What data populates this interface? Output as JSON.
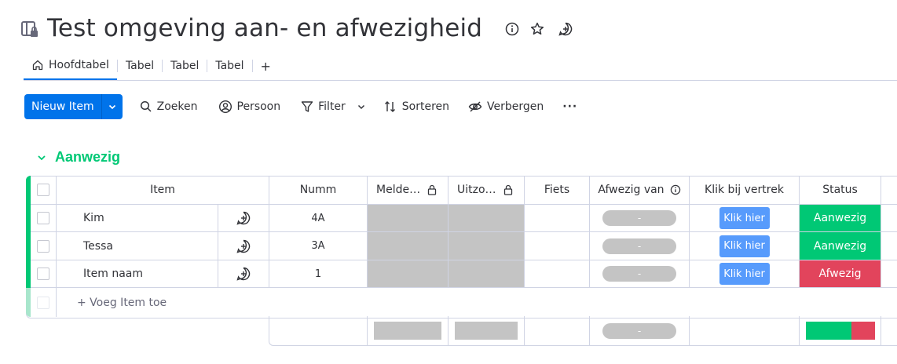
{
  "board": {
    "title": "Test omgeving aan- en afwezigheid",
    "icons": [
      "board-lock-icon",
      "info-icon",
      "star-icon",
      "add-update-icon"
    ]
  },
  "tabs": [
    {
      "label": "Hoofdtabel",
      "icon": "home-icon",
      "active": true
    },
    {
      "label": "Tabel"
    },
    {
      "label": "Tabel"
    },
    {
      "label": "Tabel"
    },
    {
      "label": "+"
    }
  ],
  "toolbar": {
    "new_item": "Nieuw Item",
    "search": "Zoeken",
    "person": "Persoon",
    "filter": "Filter",
    "sort": "Sorteren",
    "hide": "Verbergen",
    "more": "···"
  },
  "group": {
    "title": "Aanwezig",
    "color": "#00c875",
    "columns": [
      "Item",
      "Numm",
      "Melde…",
      "Uitzo…",
      "Fiets",
      "Afwezig van",
      "Klik bij vertrek",
      "Status"
    ],
    "rows": [
      {
        "item": "Kim",
        "numm": "4A",
        "afwezig": "-",
        "klik": "Klik hier",
        "status": "Aanwezig",
        "status_color": "#00c875"
      },
      {
        "item": "Tessa",
        "numm": "3A",
        "afwezig": "-",
        "klik": "Klik hier",
        "status": "Aanwezig",
        "status_color": "#00c875"
      },
      {
        "item": "Item naam",
        "numm": "1",
        "afwezig": "-",
        "klik": "Klik hier",
        "status": "Afwezig",
        "status_color": "#e2445c"
      }
    ],
    "add_item": "+ Voeg Item toe",
    "summary": {
      "afwezig": "-",
      "status_distribution": [
        {
          "label": "Aanwezig",
          "fraction": 0.667,
          "color": "#00c875"
        },
        {
          "label": "Afwezig",
          "fraction": 0.333,
          "color": "#e2445c"
        }
      ]
    }
  }
}
